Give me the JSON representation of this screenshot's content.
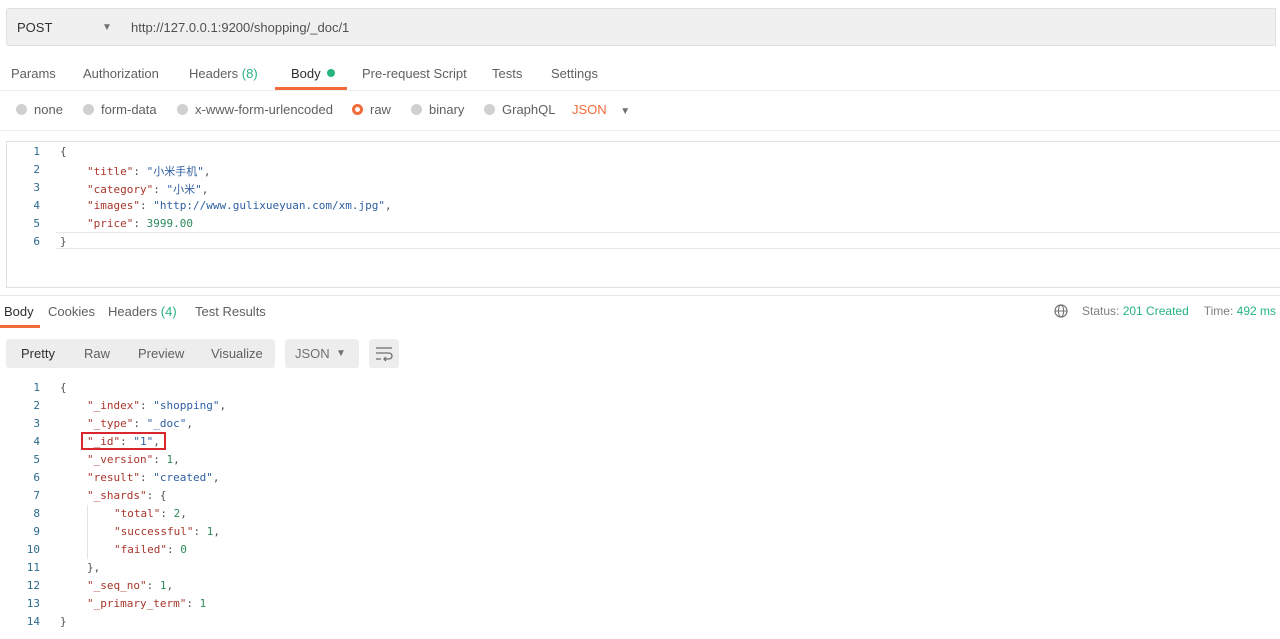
{
  "request": {
    "method": "POST",
    "url": "http://127.0.0.1:9200/shopping/_doc/1",
    "tabs": {
      "params": "Params",
      "authorization": "Authorization",
      "headers": "Headers",
      "headers_count": "(8)",
      "body": "Body",
      "prerequest": "Pre-request Script",
      "tests": "Tests",
      "settings": "Settings"
    },
    "body_types": {
      "none": "none",
      "form_data": "form-data",
      "urlencoded": "x-www-form-urlencoded",
      "raw": "raw",
      "binary": "binary",
      "graphql": "GraphQL",
      "format": "JSON"
    },
    "line_numbers": [
      "1",
      "2",
      "3",
      "4",
      "5",
      "6"
    ],
    "body_lines": {
      "l1": "{",
      "l2_key": "\"title\"",
      "l2_val": "\"小米手机\"",
      "l3_key": "\"category\"",
      "l3_val": "\"小米\"",
      "l4_key": "\"images\"",
      "l4_val": "\"http://www.gulixueyuan.com/xm.jpg\"",
      "l5_key": "\"price\"",
      "l5_val": "3999.00",
      "l6": "}"
    }
  },
  "response": {
    "tabs": {
      "body": "Body",
      "cookies": "Cookies",
      "headers": "Headers",
      "headers_count": "(4)",
      "test_results": "Test Results"
    },
    "status_label": "Status:",
    "status_value": "201 Created",
    "time_label": "Time:",
    "time_value": "492 ms",
    "formats": {
      "pretty": "Pretty",
      "raw": "Raw",
      "preview": "Preview",
      "visualize": "Visualize"
    },
    "language": "JSON",
    "line_numbers": [
      "1",
      "2",
      "3",
      "4",
      "5",
      "6",
      "7",
      "8",
      "9",
      "10",
      "11",
      "12",
      "13",
      "14"
    ],
    "body_lines": {
      "l1": "{",
      "l2_key": "\"_index\"",
      "l2_val": "\"shopping\"",
      "l3_key": "\"_type\"",
      "l3_val": "\"_doc\"",
      "l4_key": "\"_id\"",
      "l4_val": "\"1\"",
      "l5_key": "\"_version\"",
      "l5_val": "1",
      "l6_key": "\"result\"",
      "l6_val": "\"created\"",
      "l7_key": "\"_shards\"",
      "l7_val": "{",
      "l8_key": "\"total\"",
      "l8_val": "2",
      "l9_key": "\"successful\"",
      "l9_val": "1",
      "l10_key": "\"failed\"",
      "l10_val": "0",
      "l11": "},",
      "l12_key": "\"_seq_no\"",
      "l12_val": "1",
      "l13_key": "\"_primary_term\"",
      "l13_val": "1",
      "l14": "}"
    }
  },
  "icons": {
    "globe": "globe-icon",
    "wrap": "wrap-lines-icon",
    "caret": "chevron-down-icon"
  },
  "colors": {
    "accent": "#f26b3a",
    "success": "#26b47f",
    "highlight": "#d9272e"
  }
}
